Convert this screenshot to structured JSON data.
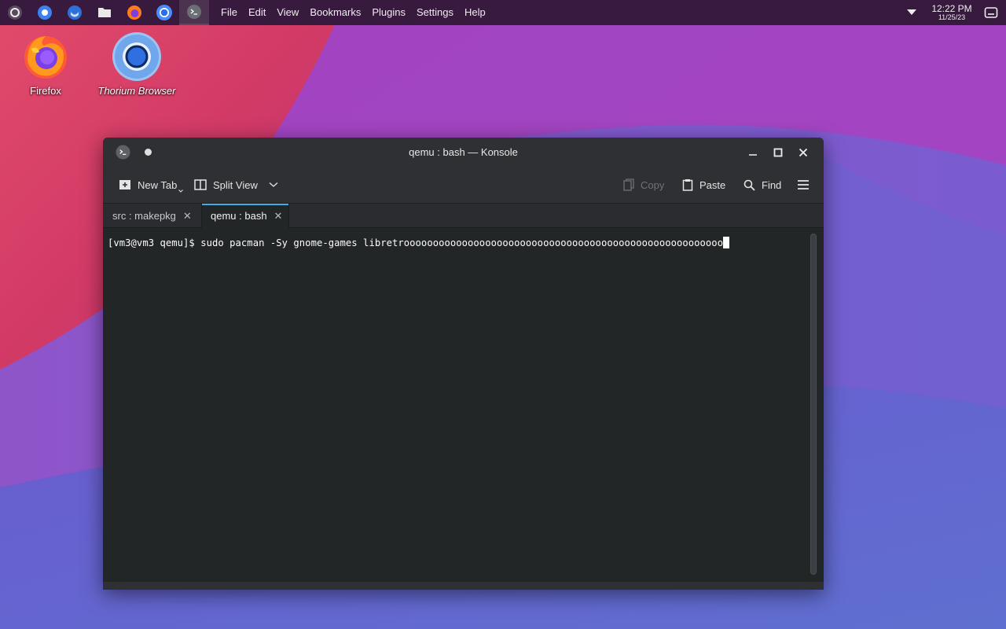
{
  "panel": {
    "taskbar": [
      {
        "name": "app-launcher-icon",
        "active": false
      },
      {
        "name": "discover-icon",
        "active": false
      },
      {
        "name": "thunderbird-icon",
        "active": false
      },
      {
        "name": "file-manager-icon",
        "active": false
      },
      {
        "name": "firefox-icon",
        "active": false
      },
      {
        "name": "thorium-browser-icon",
        "active": false
      },
      {
        "name": "konsole-icon",
        "active": true
      }
    ],
    "menu": [
      "File",
      "Edit",
      "View",
      "Bookmarks",
      "Plugins",
      "Settings",
      "Help"
    ],
    "clock_time": "12:22 PM",
    "clock_date": "11/25/23"
  },
  "desktop": {
    "icons": [
      {
        "label": "Firefox"
      },
      {
        "label": "Thorium Browser"
      }
    ]
  },
  "window": {
    "title": "qemu : bash — Konsole",
    "toolbar": {
      "new_tab": "New Tab",
      "split_view": "Split View",
      "copy": "Copy",
      "paste": "Paste",
      "find": "Find"
    },
    "tabs": [
      {
        "label": "src : makepkg",
        "active": false
      },
      {
        "label": "qemu : bash",
        "active": true
      }
    ],
    "terminal": {
      "prompt": "[vm3@vm3 qemu]$ ",
      "command": "sudo pacman -Sy gnome-games libretrooooooooooooooooooooooooooooooooooooooooooooooooooooooo"
    }
  },
  "colors": {
    "panel_bg": "#371a3e",
    "terminal_bg": "#232627",
    "window_chrome": "#2f3033",
    "accent": "#3daee9"
  }
}
